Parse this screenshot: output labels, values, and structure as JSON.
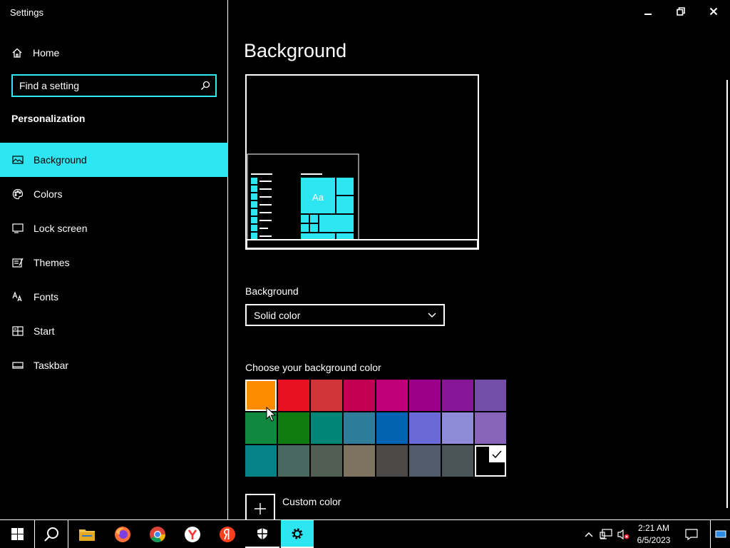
{
  "window": {
    "title": "Settings"
  },
  "controls": {
    "minimize_icon": "minimize-icon",
    "restore_icon": "restore-icon",
    "close_icon": "close-icon"
  },
  "sidebar": {
    "home_label": "Home",
    "search": {
      "placeholder": "Find a setting",
      "value": ""
    },
    "section_title": "Personalization",
    "items": [
      {
        "label": "Background",
        "icon": "picture-icon",
        "active": true
      },
      {
        "label": "Colors",
        "icon": "palette-icon",
        "active": false
      },
      {
        "label": "Lock screen",
        "icon": "lock-screen-icon",
        "active": false
      },
      {
        "label": "Themes",
        "icon": "themes-icon",
        "active": false
      },
      {
        "label": "Fonts",
        "icon": "fonts-icon",
        "active": false
      },
      {
        "label": "Start",
        "icon": "start-icon",
        "active": false
      },
      {
        "label": "Taskbar",
        "icon": "taskbar-icon",
        "active": false
      }
    ]
  },
  "main": {
    "title": "Background",
    "preview": {
      "tile_text": "Aa"
    },
    "background_label": "Background",
    "background_value": "Solid color",
    "choose_label": "Choose your background color",
    "colors": [
      "#ff8c00",
      "#e81123",
      "#d13438",
      "#c30052",
      "#bf0077",
      "#9a0089",
      "#881798",
      "#744da9",
      "#10893e",
      "#107c10",
      "#018574",
      "#2d7d9a",
      "#0063b1",
      "#6b69d6",
      "#8e8cd8",
      "#8764b8",
      "#038387",
      "#486860",
      "#525e54",
      "#7e735f",
      "#4c4a48",
      "#515c6b",
      "#4a5459",
      "#000000"
    ],
    "selected_color": "#000000",
    "custom_color_label": "Custom color"
  },
  "taskbar": {
    "apps": [
      "start-icon",
      "search-icon",
      "file-explorer-icon",
      "firefox-icon",
      "chrome-icon",
      "yandex-browser-icon",
      "yandex-icon",
      "security-icon",
      "settings-icon"
    ],
    "time": "2:21 AM",
    "date": "6/5/2023"
  },
  "accent": "#2ee6f2"
}
